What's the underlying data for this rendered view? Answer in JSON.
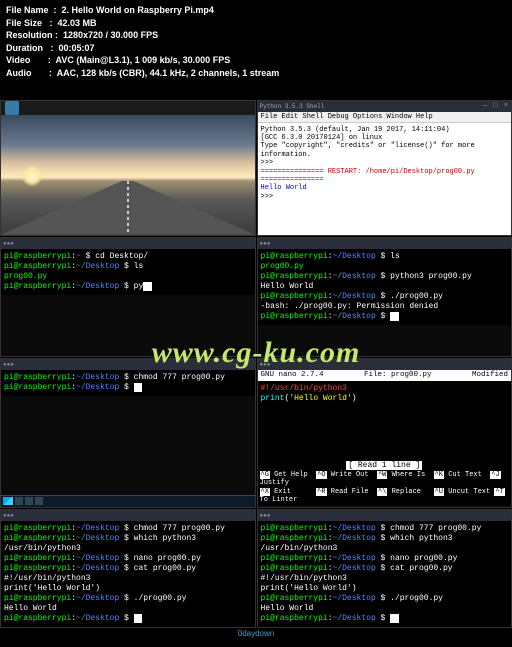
{
  "meta": {
    "file_name_label": "File Name  :  ",
    "file_name": "2. Hello World on Raspberry Pi.mp4",
    "file_size_label": "File Size   :  ",
    "file_size": "42.03 MB",
    "resolution_label": "Resolution :  ",
    "resolution": "1280x720 / 30.000 FPS",
    "duration_label": "Duration   :  ",
    "duration": "00:05:07",
    "video_label": "Video       :  ",
    "video": "AVC (Main@L3.1), 1 009 kb/s, 30.000 FPS",
    "audio_label": "Audio       :  ",
    "audio": "AAC, 128 kb/s (CBR), 44.1 kHz, 2 channels, 1 stream"
  },
  "watermark": "www.cg-ku.com",
  "idle": {
    "title": "Python 3.5.3 Shell",
    "menus": "File  Edit  Shell  Debug  Options  Window  Help",
    "line1": "Python 3.5.3 (default, Jan 19 2017, 14:11:04)",
    "line2": "[GCC 6.3.0 20170124] on linux",
    "line3": "Type \"copyright\", \"credits\" or \"license()\" for more information.",
    "line4": ">>>",
    "restart": "=============== RESTART: /home/pi/Desktop/prog00.py ===============",
    "output": "Hello World",
    "prompt": ">>> "
  },
  "term1": {
    "p1_cmd": "cd Desktop/",
    "p2_cmd": "ls",
    "ls_out": "prog00.py",
    "p3_cmd": "py"
  },
  "term2": {
    "p1_cmd": "ls",
    "ls_out": "prog00.py",
    "p2_cmd": "python3 prog00.py",
    "out1": "Hello World",
    "p3_cmd": "./prog00.py",
    "err": "-bash: ./prog00.py: Permission denied",
    "p4_cmd": ""
  },
  "term3": {
    "p1_cmd": "chmod 777 prog00.py",
    "p2_cmd": ""
  },
  "nano": {
    "version": "GNU nano 2.7.4",
    "file": "File: prog00.py",
    "modified": "Modified",
    "line1": "#!/usr/bin/python3",
    "line2": "print('Hello World')",
    "status": "[ Read 1 line ]",
    "k_g": "^G",
    "l_g": "Get Help",
    "k_o": "^O",
    "l_o": "Write Out",
    "k_w": "^W",
    "l_w": "Where Is",
    "k_k": "^K",
    "l_k": "Cut Text",
    "k_j": "^J",
    "l_j": "Justify",
    "k_x": "^X",
    "l_x": "Exit",
    "k_r": "^R",
    "l_r": "Read File",
    "k_bs": "^\\",
    "l_bs": "Replace",
    "k_u": "^U",
    "l_u": "Uncut Text",
    "k_t": "^T",
    "l_t": "To Linter"
  },
  "term5": {
    "p1_cmd": "chmod 777 prog00.py",
    "p2_cmd": "which python3",
    "out1": "/usr/bin/python3",
    "p3_cmd": "nano prog00.py",
    "p4_cmd": "cat prog00.py",
    "cat1": "#!/usr/bin/python3",
    "cat2": "print('Hello World')",
    "p5_cmd": "./prog00.py",
    "out2": "Hello World",
    "p6_cmd": ""
  },
  "term6": {
    "p1_cmd": "chmod 777 prog00.py",
    "p2_cmd": "which python3",
    "out1": "/usr/bin/python3",
    "p3_cmd": "nano prog00.py",
    "p4_cmd": "cat prog00.py",
    "cat1": "#!/usr/bin/python3",
    "cat2": "print('Hello World')",
    "p5_cmd": "./prog00.py",
    "out2": "Hello World",
    "p6_cmd": ""
  },
  "prompt": {
    "user_home": "pi@raspberrypi",
    "home_path": "~",
    "desk_path": "~/Desktop",
    "sep": ":",
    "dollar": " $ "
  },
  "footer": "0daydown"
}
